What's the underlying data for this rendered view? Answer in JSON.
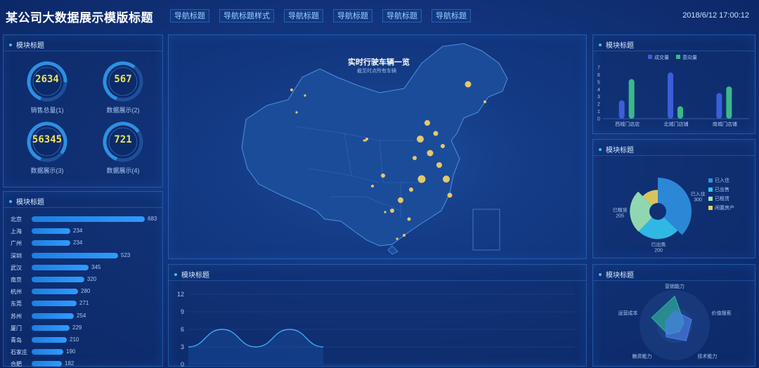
{
  "header": {
    "brand": "某公司大数据展示模版标题",
    "nav": [
      "导航标题",
      "导航标题样式",
      "导航标题",
      "导航标题",
      "导航标题",
      "导航标题"
    ],
    "datetime": "2018/6/12 17:00:12"
  },
  "panels": {
    "gauges_title": "模块标题",
    "cities_title": "模块标题",
    "bars_title": "模块标题",
    "pie_title": "模块标题",
    "radar_title": "模块标题",
    "line_title": "模块标题"
  },
  "gauges": [
    {
      "value": "2634",
      "label": "销售总量(1)",
      "ratio": 0.7
    },
    {
      "value": "567",
      "label": "数据展示(2)",
      "ratio": 0.55
    },
    {
      "value": "56345",
      "label": "数据展示(3)",
      "ratio": 0.8
    },
    {
      "value": "721",
      "label": "数据展示(4)",
      "ratio": 0.6
    }
  ],
  "map": {
    "title": "实时行驶车辆一览",
    "subtitle": "截至时点所有车辆"
  },
  "cities": [
    {
      "name": "北京",
      "value": 683
    },
    {
      "name": "上海",
      "value": 234
    },
    {
      "name": "广州",
      "value": 234
    },
    {
      "name": "深圳",
      "value": 523
    },
    {
      "name": "武汉",
      "value": 345
    },
    {
      "name": "南京",
      "value": 320
    },
    {
      "name": "杭州",
      "value": 280
    },
    {
      "name": "东莞",
      "value": 271
    },
    {
      "name": "苏州",
      "value": 254
    },
    {
      "name": "厦门",
      "value": 229
    },
    {
      "name": "青岛",
      "value": 210
    },
    {
      "name": "石家庄",
      "value": 190
    },
    {
      "name": "合肥",
      "value": 182
    }
  ],
  "chart_data": [
    {
      "type": "bar",
      "categories": [
        "西城门店店",
        "北城门店铺",
        "南城门店铺"
      ],
      "series": [
        {
          "name": "成交量",
          "values": [
            2.5,
            6.3,
            3.5
          ]
        },
        {
          "name": "意向量",
          "values": [
            5.4,
            1.7,
            4.4
          ]
        }
      ],
      "ylim": [
        0,
        7
      ],
      "yticks": [
        "0",
        "1",
        "2",
        "3",
        "4",
        "5",
        "6",
        "7"
      ],
      "colors": [
        "#3d5ed8",
        "#3ab88a"
      ]
    },
    {
      "type": "pie",
      "labels": [
        "已入住",
        "已出售",
        "已租赁",
        "闲置房产"
      ],
      "values": [
        300,
        200,
        205,
        100
      ],
      "value_labels": [
        "300",
        "200",
        "205"
      ],
      "colors": [
        "#2f8fe0",
        "#33c4ee",
        "#9be6b6",
        "#e8d25a"
      ]
    },
    {
      "type": "radar",
      "indicators": [
        "营销能力",
        "价值搜索",
        "技术能力",
        "融资能力",
        "运营成本"
      ],
      "series": [
        {
          "values": [
            0.9,
            0.3,
            0.25,
            0.35,
            0.75
          ],
          "color": "#2fb39a"
        },
        {
          "values": [
            0.45,
            0.55,
            0.6,
            0.45,
            0.3
          ],
          "color": "#4a7fe6"
        }
      ]
    },
    {
      "type": "line",
      "yticks": [
        "0",
        "3",
        "6",
        "9",
        "12"
      ],
      "ylim": [
        0,
        12
      ],
      "points": [
        3,
        6,
        3,
        6,
        3
      ],
      "color": "#3fa9f5"
    }
  ]
}
